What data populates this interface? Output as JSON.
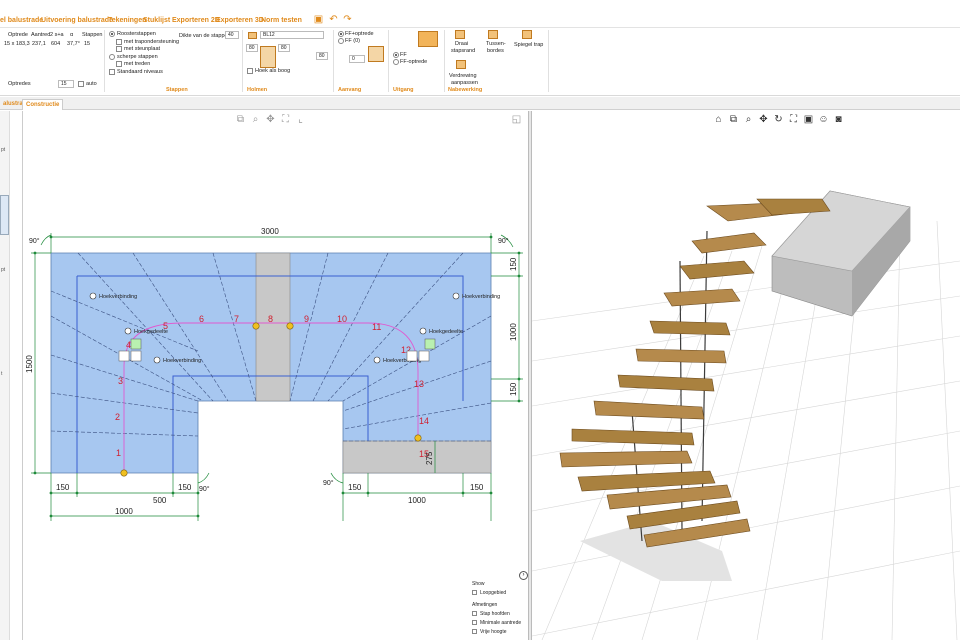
{
  "menubar": {
    "items": [
      "el balustrade",
      "Uitvoering balustrade",
      "Tekeningen",
      "Stuklijst",
      "Exporteren 2D",
      "Exporteren 3D",
      "Norm testen"
    ],
    "quick_access": [
      "save-icon",
      "undo-icon",
      "redo-icon"
    ]
  },
  "ribbon": {
    "summary_headers": [
      "Optrede",
      "Aantred",
      "2 s+a",
      "α",
      "Stappen"
    ],
    "summary_values": [
      "15 x 183,3",
      "237,1",
      "604",
      "37,7°",
      "15"
    ],
    "optredes_label": "Optredes",
    "optredes_value": "15",
    "auto_label": "auto",
    "steps": {
      "roosterstappen": "Roosterstappen",
      "trapondersteuning": "met trapondersteuning",
      "steunplaat": "met steunplaat",
      "scherpe": "scherpe stappen",
      "treden": "met treden",
      "standaard": "Standaard niveaus",
      "dikte_label": "Dikte van de stappen",
      "dikte_value": "40",
      "group": "Stappen"
    },
    "holmen": {
      "profile": "BL12",
      "v1": "80",
      "v2": "80",
      "v3": "80",
      "hoek": "Hoek als boog",
      "group": "Holmen"
    },
    "aanvang": {
      "opt1": "FF+optrede",
      "opt2": "FF (0)",
      "value": "0",
      "group": "Aanvang"
    },
    "uitgang": {
      "opt1": "FF",
      "opt2": "FF-optrede",
      "group": "Uitgang"
    },
    "nabewerking": {
      "btn1_l1": "Draai",
      "btn1_l2": "stapsrand",
      "btn2_l1": "Tussen-",
      "btn2_l2": "bordes",
      "btn3": "Spiegel trap",
      "btn4_l1": "Verdrewing",
      "btn4_l2": "aanpassen",
      "group": "Nabewerking"
    }
  },
  "tabs": [
    "alustrade",
    "Constructie"
  ],
  "left_marks": [
    "pt",
    "pt",
    "t"
  ],
  "plan": {
    "dim_top": "3000",
    "dim_left": "1500",
    "dim_right_top": "150",
    "dim_right_mid": "1000",
    "dim_right_bot": "150",
    "dim_b150a": "150",
    "dim_b500": "500",
    "dim_b150b": "150",
    "dim_b1000l": "1000",
    "dim_b1000r": "1000",
    "dim_b150c": "150",
    "dim_b150d": "150",
    "dim_275": "275",
    "angle": "90°",
    "hoekgedeelte": "Hoekgedeelte",
    "hoekverbinding": "Hoekverbinding",
    "step_numbers": [
      "1",
      "2",
      "3",
      "4",
      "5",
      "6",
      "7",
      "8",
      "9",
      "10",
      "11",
      "12",
      "13",
      "14",
      "15"
    ]
  },
  "show": {
    "title": "Show",
    "loopgebied": "Loopgebied",
    "afmetingen": "Afmetingen",
    "stap": "Stap hoofden",
    "minimale": "Minimale aantrede",
    "vrije": "Vrije hoogte"
  },
  "toolbar3d": [
    "home-icon",
    "zoom-window-icon",
    "zoom-icon",
    "pan-icon",
    "rotate-icon",
    "fit-icon",
    "box-icon",
    "person-icon",
    "camera-icon"
  ],
  "toolbar2d": [
    "zoom-window-icon",
    "zoom-icon",
    "pan-icon",
    "fit-icon",
    "measure-icon"
  ]
}
